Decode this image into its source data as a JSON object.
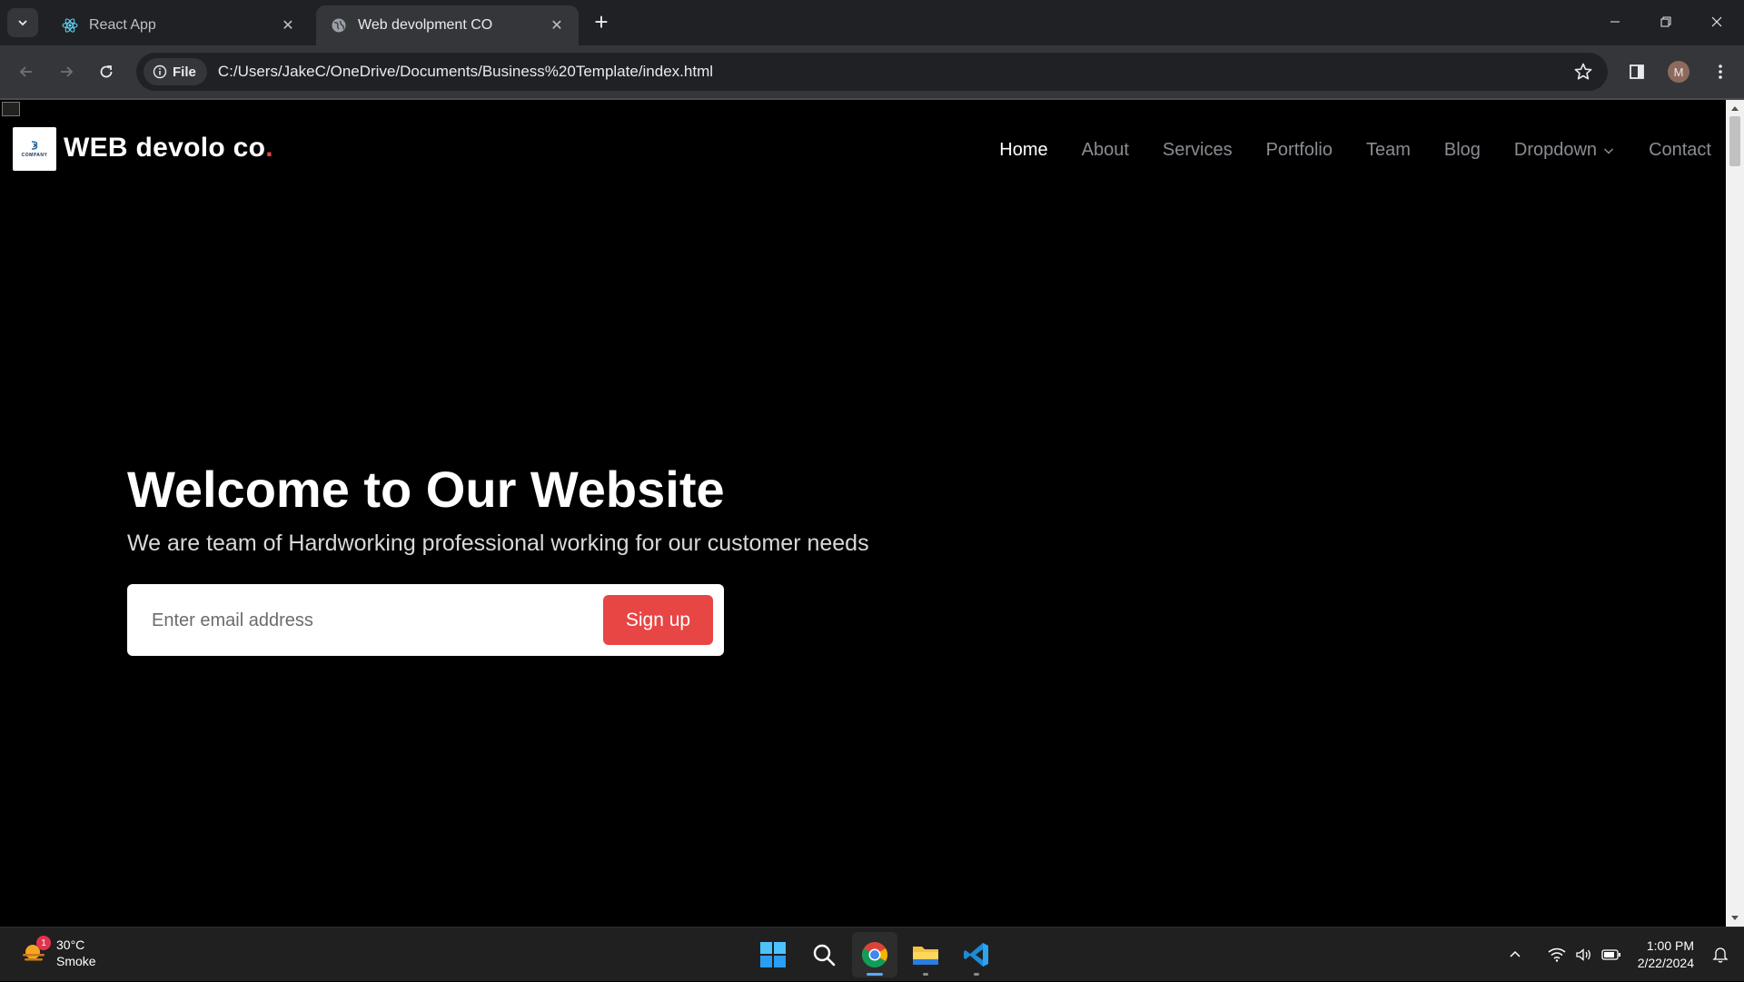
{
  "browser": {
    "tabs": [
      {
        "title": "React App",
        "favicon": "react-icon",
        "active": false
      },
      {
        "title": "Web devolpment CO",
        "favicon": "globe-icon",
        "active": true
      }
    ],
    "address_bar": {
      "scheme_label": "File",
      "url": "C:/Users/JakeC/OneDrive/Documents/Business%20Template/index.html"
    },
    "profile_initial": "M",
    "accent_color": "#35363a"
  },
  "site": {
    "brand": {
      "name": "WEB devolo co",
      "dot": ".",
      "logo_text": "COMPANY"
    },
    "nav": [
      {
        "label": "Home",
        "active": true
      },
      {
        "label": "About",
        "active": false
      },
      {
        "label": "Services",
        "active": false
      },
      {
        "label": "Portfolio",
        "active": false
      },
      {
        "label": "Team",
        "active": false
      },
      {
        "label": "Blog",
        "active": false
      },
      {
        "label": "Dropdown",
        "active": false,
        "has_chevron": true
      },
      {
        "label": "Contact",
        "active": false
      }
    ],
    "hero": {
      "title": "Welcome to Our Website",
      "subtitle": "We are team of Hardworking professional working for our customer needs",
      "email_placeholder": "Enter email address",
      "signup_label": "Sign up"
    },
    "colors": {
      "accent": "#e84545",
      "background": "#000000",
      "nav_active": "#ffffff",
      "nav_inactive": "#8a8d91"
    }
  },
  "taskbar": {
    "weather": {
      "temperature": "30°C",
      "condition": "Smoke",
      "badge": "1"
    },
    "apps": [
      "windows-start-icon",
      "search-icon",
      "chrome-icon",
      "file-explorer-icon",
      "vscode-icon"
    ],
    "clock": {
      "time": "1:00 PM",
      "date": "2/22/2024"
    }
  }
}
